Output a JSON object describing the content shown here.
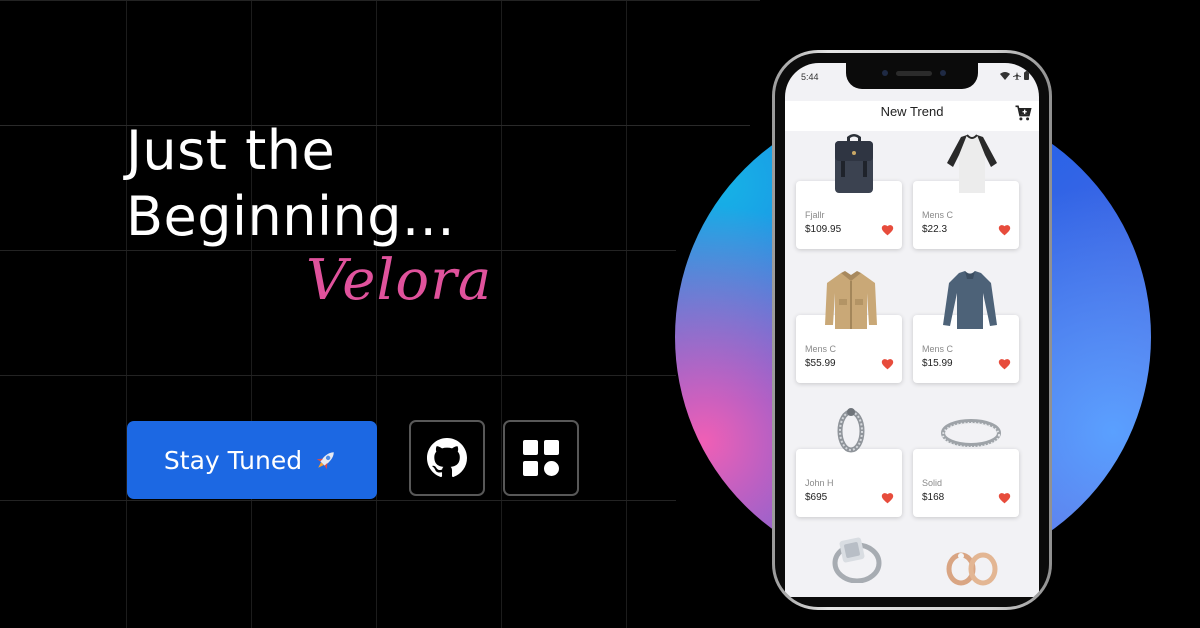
{
  "hero": {
    "headline_line1": "Just the",
    "headline_line2": "Beginning...",
    "brand": "Velora"
  },
  "cta": {
    "label": "Stay Tuned"
  },
  "links": [
    {
      "icon": "github-icon"
    },
    {
      "icon": "apps-grid-icon"
    }
  ],
  "phone": {
    "status": {
      "time": "5:44"
    },
    "appbar": {
      "title": "New Trend"
    },
    "products": [
      {
        "name": "Fjallr",
        "price": "$109.95",
        "image": "backpack"
      },
      {
        "name": "Mens C",
        "price": "$22.3",
        "image": "raglan-tshirt"
      },
      {
        "name": "Mens C",
        "price": "$55.99",
        "image": "jacket"
      },
      {
        "name": "Mens C",
        "price": "$15.99",
        "image": "long-sleeve-shirt"
      },
      {
        "name": "John H",
        "price": "$695",
        "image": "bracelet"
      },
      {
        "name": "Solid",
        "price": "$168",
        "image": "ring"
      },
      {
        "name": "",
        "price": "",
        "image": "diamond-ring"
      },
      {
        "name": "",
        "price": "",
        "image": "rose-gold-rings"
      }
    ]
  },
  "colors": {
    "background": "#000000",
    "cta": "#1c68e3",
    "brand": "#e0529c",
    "heart": "#e74c3c"
  }
}
